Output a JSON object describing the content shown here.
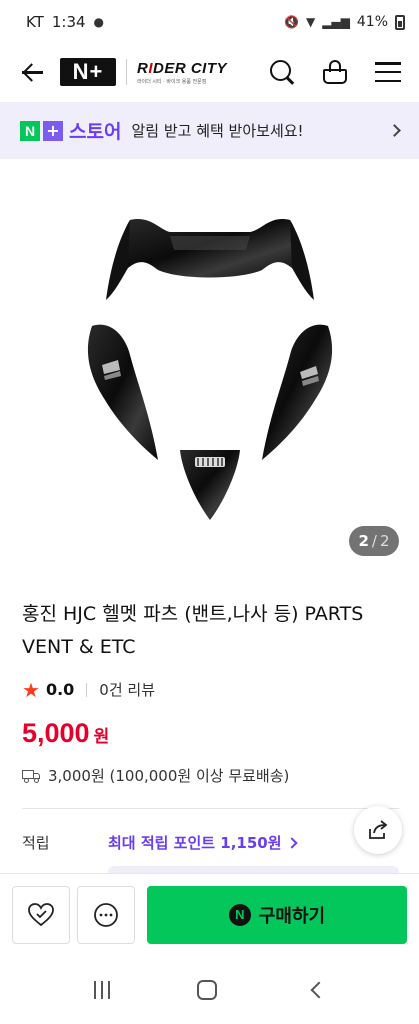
{
  "status_bar": {
    "carrier": "KT",
    "time": "1:34",
    "battery": "41%"
  },
  "header": {
    "npay_label": "N+",
    "brand_logo": "RIDER CITY",
    "brand_sub": "라이더 시티 · 바이크 용품 전문점"
  },
  "store_banner": {
    "store_label": "스토어",
    "message": "알림 받고 혜택 받아보세요!"
  },
  "gallery": {
    "current_page": "2",
    "total_pages": "2"
  },
  "product": {
    "title": "홍진 HJC 헬멧 파츠 (밴트,나사 등) PARTS VENT & ETC",
    "rating": "0.0",
    "reviews": "0건 리뷰",
    "price": "5,000",
    "currency": "원",
    "shipping": "3,000원 (100,000원 이상 무료배송)",
    "points_label": "적립",
    "points_value": "최대 적립 포인트 1,150원"
  },
  "bottom_bar": {
    "buy_label": "구매하기"
  },
  "colors": {
    "naver_green": "#03c75a",
    "store_purple": "#6a3df0",
    "price_red": "#e4002b",
    "banner_bg": "#f1eefc"
  }
}
